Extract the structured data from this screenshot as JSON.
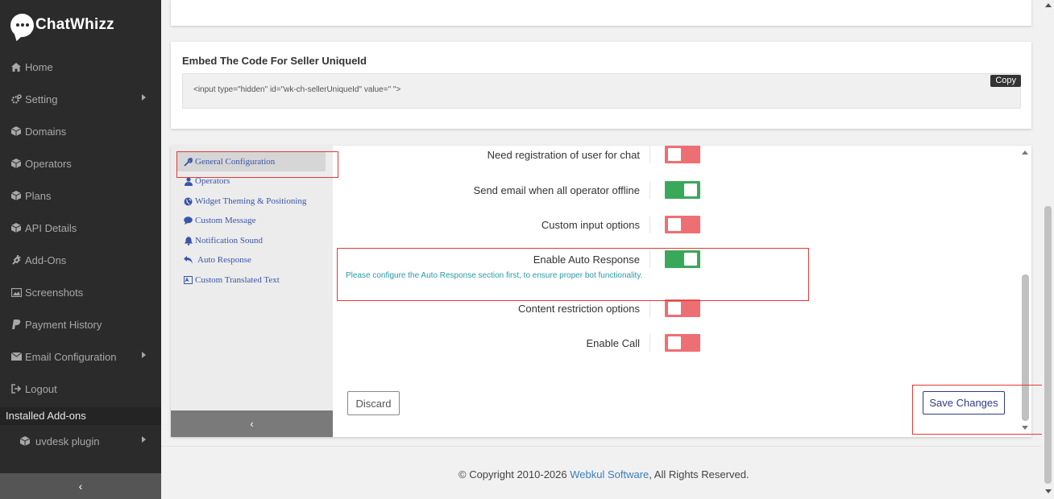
{
  "app": {
    "brand": "ChatWhizz"
  },
  "sidebar": {
    "items": [
      {
        "label": "Home",
        "icon": "home-icon",
        "has_submenu": false
      },
      {
        "label": "Setting",
        "icon": "cogs-icon",
        "has_submenu": true
      },
      {
        "label": "Domains",
        "icon": "cube-icon",
        "has_submenu": false
      },
      {
        "label": "Operators",
        "icon": "cube-icon",
        "has_submenu": false
      },
      {
        "label": "Plans",
        "icon": "cube-icon",
        "has_submenu": false
      },
      {
        "label": "API Details",
        "icon": "cube-icon",
        "has_submenu": false
      },
      {
        "label": "Add-Ons",
        "icon": "plug-icon",
        "has_submenu": false
      },
      {
        "label": "Screenshots",
        "icon": "image-icon",
        "has_submenu": false
      },
      {
        "label": "Payment History",
        "icon": "paypal-icon",
        "has_submenu": false
      },
      {
        "label": "Email Configuration",
        "icon": "envelope-icon",
        "has_submenu": true
      },
      {
        "label": "Logout",
        "icon": "sign-out-icon",
        "has_submenu": false
      }
    ],
    "installed_addons_label": "Installed Add-ons",
    "addon_items": [
      {
        "label": "uvdesk plugin",
        "icon": "cube-icon",
        "has_submenu": true
      }
    ],
    "collapse_glyph": "‹"
  },
  "embed": {
    "title": "Embed The Code For Seller UniqueId",
    "code": "<input type=\"hidden\" id=\"wk-ch-sellerUniqueId\" value=\" \">",
    "copy_label": "Copy"
  },
  "config_menu": {
    "items": [
      {
        "label": "General Configuration",
        "icon": "wrench-icon",
        "active": true
      },
      {
        "label": "Operators",
        "icon": "user-icon",
        "active": false
      },
      {
        "label": "Widget Theming & Positioning",
        "icon": "globe-icon",
        "active": false
      },
      {
        "label": "Custom Message",
        "icon": "comment-icon",
        "active": false
      },
      {
        "label": "Notification Sound",
        "icon": "bell-icon",
        "active": false
      },
      {
        "label": "Auto Response",
        "icon": "reply-icon",
        "active": false
      },
      {
        "label": "Custom Translated Text",
        "icon": "language-icon",
        "active": false
      }
    ],
    "collapse_glyph": "‹"
  },
  "settings": {
    "rows": [
      {
        "label": "Need registration of user for chat",
        "enabled": false
      },
      {
        "label": "Send email when all operator offline",
        "enabled": true
      },
      {
        "label": "Custom input options",
        "enabled": false
      },
      {
        "label": "Enable Auto Response",
        "enabled": true
      },
      {
        "label": "Content restriction options",
        "enabled": false
      },
      {
        "label": "Enable Call",
        "enabled": false
      }
    ],
    "auto_response_note": "Please configure the Auto Response section first, to ensure proper bot functionality."
  },
  "actions": {
    "discard_label": "Discard",
    "save_label": "Save Changes"
  },
  "footer": {
    "prefix": "© Copyright 2010-2026 ",
    "company": "Webkul Software",
    "suffix": ", All Rights Reserved."
  },
  "colors": {
    "sidebar_bg": "#2b2b2b",
    "toggle_on": "#3aa85a",
    "toggle_off": "#ee6f73",
    "link": "#3a55a8",
    "highlight": "#e53935"
  }
}
